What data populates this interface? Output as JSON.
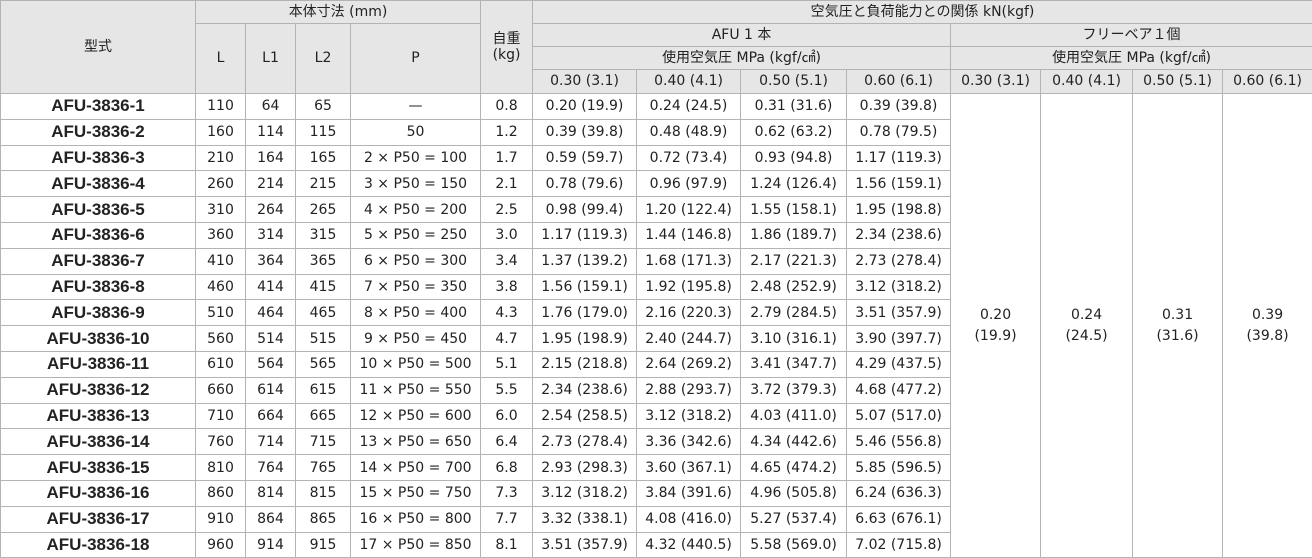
{
  "header": {
    "model": "型式",
    "body_dims": "本体寸法 (mm)",
    "dim_cols": [
      "L",
      "L1",
      "L2",
      "P"
    ],
    "weight_line1": "自重",
    "weight_line2": "(kg)",
    "load_title": "空気圧と負荷能力との関係 kN(kgf)",
    "afu_one": "AFU 1 本",
    "free_bearing": "フリーベア１個",
    "pressure_label": "使用空気圧 MPa (kgf/㎠)",
    "pressures": [
      "0.30 (3.1)",
      "0.40 (4.1)",
      "0.50 (5.1)",
      "0.60 (6.1)"
    ]
  },
  "free_bearing_values": [
    {
      "kn": "0.20",
      "kgf": "(19.9)"
    },
    {
      "kn": "0.24",
      "kgf": "(24.5)"
    },
    {
      "kn": "0.31",
      "kgf": "(31.6)"
    },
    {
      "kn": "0.39",
      "kgf": "(39.8)"
    }
  ],
  "rows": [
    {
      "model": "AFU-3836-1",
      "L": "110",
      "L1": "64",
      "L2": "65",
      "P": "—",
      "w": "0.8",
      "loads": [
        "0.20 (19.9)",
        "0.24 (24.5)",
        "0.31 (31.6)",
        "0.39 (39.8)"
      ]
    },
    {
      "model": "AFU-3836-2",
      "L": "160",
      "L1": "114",
      "L2": "115",
      "P": "50",
      "w": "1.2",
      "loads": [
        "0.39 (39.8)",
        "0.48 (48.9)",
        "0.62 (63.2)",
        "0.78 (79.5)"
      ]
    },
    {
      "model": "AFU-3836-3",
      "L": "210",
      "L1": "164",
      "L2": "165",
      "P": "2 × P50 = 100",
      "w": "1.7",
      "loads": [
        "0.59 (59.7)",
        "0.72 (73.4)",
        "0.93 (94.8)",
        "1.17 (119.3)"
      ]
    },
    {
      "model": "AFU-3836-4",
      "L": "260",
      "L1": "214",
      "L2": "215",
      "P": "3 × P50 = 150",
      "w": "2.1",
      "loads": [
        "0.78 (79.6)",
        "0.96 (97.9)",
        "1.24 (126.4)",
        "1.56 (159.1)"
      ]
    },
    {
      "model": "AFU-3836-5",
      "L": "310",
      "L1": "264",
      "L2": "265",
      "P": "4 × P50 = 200",
      "w": "2.5",
      "loads": [
        "0.98 (99.4)",
        "1.20 (122.4)",
        "1.55 (158.1)",
        "1.95 (198.8)"
      ]
    },
    {
      "model": "AFU-3836-6",
      "L": "360",
      "L1": "314",
      "L2": "315",
      "P": "5 × P50 = 250",
      "w": "3.0",
      "loads": [
        "1.17 (119.3)",
        "1.44 (146.8)",
        "1.86 (189.7)",
        "2.34 (238.6)"
      ]
    },
    {
      "model": "AFU-3836-7",
      "L": "410",
      "L1": "364",
      "L2": "365",
      "P": "6 × P50 = 300",
      "w": "3.4",
      "loads": [
        "1.37 (139.2)",
        "1.68 (171.3)",
        "2.17 (221.3)",
        "2.73 (278.4)"
      ]
    },
    {
      "model": "AFU-3836-8",
      "L": "460",
      "L1": "414",
      "L2": "415",
      "P": "7 × P50 = 350",
      "w": "3.8",
      "loads": [
        "1.56 (159.1)",
        "1.92 (195.8)",
        "2.48 (252.9)",
        "3.12 (318.2)"
      ]
    },
    {
      "model": "AFU-3836-9",
      "L": "510",
      "L1": "464",
      "L2": "465",
      "P": "8 × P50 = 400",
      "w": "4.3",
      "loads": [
        "1.76 (179.0)",
        "2.16 (220.3)",
        "2.79 (284.5)",
        "3.51 (357.9)"
      ]
    },
    {
      "model": "AFU-3836-10",
      "L": "560",
      "L1": "514",
      "L2": "515",
      "P": "9 × P50 = 450",
      "w": "4.7",
      "loads": [
        "1.95 (198.9)",
        "2.40 (244.7)",
        "3.10 (316.1)",
        "3.90 (397.7)"
      ]
    },
    {
      "model": "AFU-3836-11",
      "L": "610",
      "L1": "564",
      "L2": "565",
      "P": "10 × P50 = 500",
      "w": "5.1",
      "loads": [
        "2.15 (218.8)",
        "2.64 (269.2)",
        "3.41 (347.7)",
        "4.29 (437.5)"
      ]
    },
    {
      "model": "AFU-3836-12",
      "L": "660",
      "L1": "614",
      "L2": "615",
      "P": "11 × P50 = 550",
      "w": "5.5",
      "loads": [
        "2.34 (238.6)",
        "2.88 (293.7)",
        "3.72 (379.3)",
        "4.68 (477.2)"
      ]
    },
    {
      "model": "AFU-3836-13",
      "L": "710",
      "L1": "664",
      "L2": "665",
      "P": "12 × P50 = 600",
      "w": "6.0",
      "loads": [
        "2.54 (258.5)",
        "3.12 (318.2)",
        "4.03 (411.0)",
        "5.07 (517.0)"
      ]
    },
    {
      "model": "AFU-3836-14",
      "L": "760",
      "L1": "714",
      "L2": "715",
      "P": "13 × P50 = 650",
      "w": "6.4",
      "loads": [
        "2.73 (278.4)",
        "3.36 (342.6)",
        "4.34 (442.6)",
        "5.46 (556.8)"
      ]
    },
    {
      "model": "AFU-3836-15",
      "L": "810",
      "L1": "764",
      "L2": "765",
      "P": "14 × P50 = 700",
      "w": "6.8",
      "loads": [
        "2.93 (298.3)",
        "3.60 (367.1)",
        "4.65 (474.2)",
        "5.85 (596.5)"
      ]
    },
    {
      "model": "AFU-3836-16",
      "L": "860",
      "L1": "814",
      "L2": "815",
      "P": "15 × P50 = 750",
      "w": "7.3",
      "loads": [
        "3.12 (318.2)",
        "3.84 (391.6)",
        "4.96 (505.8)",
        "6.24 (636.3)"
      ]
    },
    {
      "model": "AFU-3836-17",
      "L": "910",
      "L1": "864",
      "L2": "865",
      "P": "16 × P50 = 800",
      "w": "7.7",
      "loads": [
        "3.32 (338.1)",
        "4.08 (416.0)",
        "5.27 (537.4)",
        "6.63 (676.1)"
      ]
    },
    {
      "model": "AFU-3836-18",
      "L": "960",
      "L1": "914",
      "L2": "915",
      "P": "17 × P50 = 850",
      "w": "8.1",
      "loads": [
        "3.51 (357.9)",
        "4.32 (440.5)",
        "5.58 (569.0)",
        "7.02 (715.8)"
      ]
    }
  ]
}
